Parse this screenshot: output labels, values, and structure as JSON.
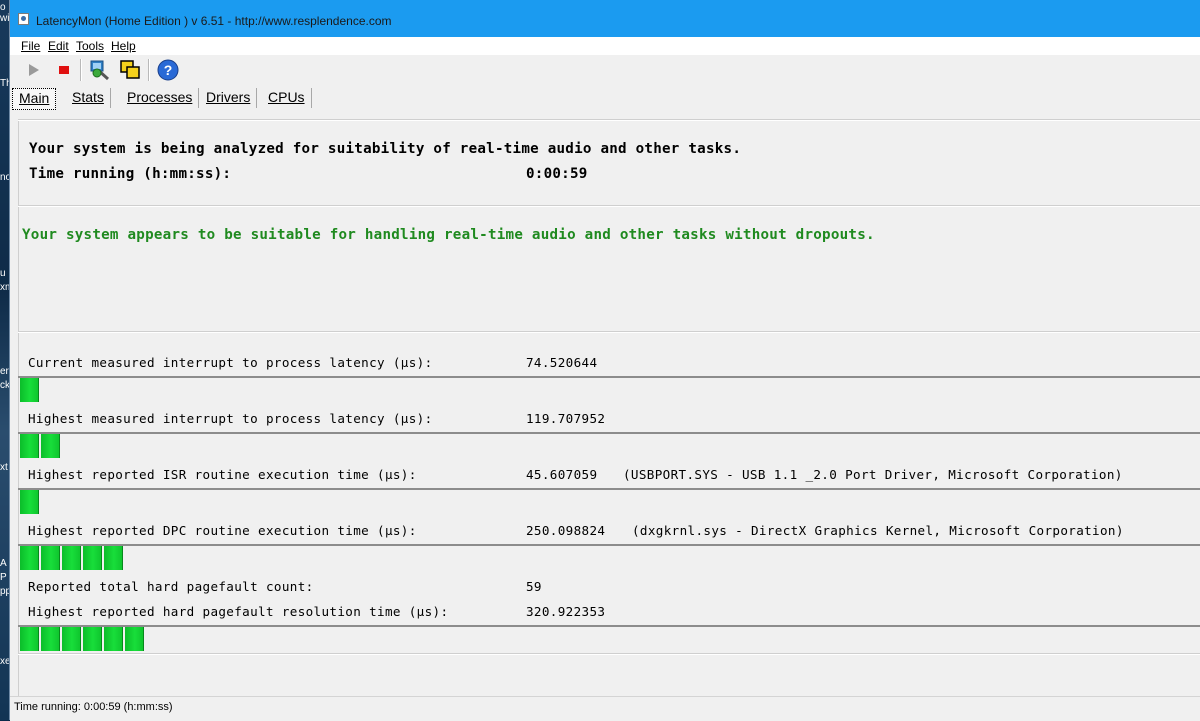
{
  "desktop": {
    "fragments": [
      "o wit",
      "Th",
      "no",
      "u",
      "xm",
      "erp",
      "ck",
      "xt",
      "A",
      "P",
      "pp",
      "xe"
    ]
  },
  "window": {
    "title": "LatencyMon  (Home Edition )  v 6.51 - http://www.resplendence.com"
  },
  "menu": {
    "items": [
      "File",
      "Edit",
      "Tools",
      "Help"
    ]
  },
  "toolbar": {
    "buttons": [
      "play-icon",
      "stop-icon",
      "analyze-icon",
      "windows-icon",
      "help-icon"
    ]
  },
  "tabs": {
    "items": [
      "Main",
      "Stats",
      "Processes",
      "Drivers",
      "CPUs"
    ],
    "active": "Main"
  },
  "main": {
    "analysis_line": "Your system is being analyzed for suitability of real-time audio and other tasks.",
    "time_label": "Time running (h:mm:ss):",
    "time_value": "0:00:59",
    "verdict": "Your system appears to be suitable for handling real-time audio and other tasks without dropouts.",
    "verdict_color": "#1f8a1f",
    "bar_color": "#18de3a",
    "metrics": [
      {
        "label": "Current measured interrupt to process latency (µs):",
        "value": "74.520644",
        "detail": "",
        "bar_segments": 1
      },
      {
        "label": "Highest measured interrupt to process latency (µs):",
        "value": "119.707952",
        "detail": "",
        "bar_segments": 2
      },
      {
        "label": "Highest reported ISR routine execution time (µs):",
        "value": "45.607059",
        "detail": "(USBPORT.SYS - USB 1.1 _2.0 Port Driver, Microsoft Corporation)",
        "bar_segments": 1
      },
      {
        "label": "Highest reported DPC routine execution time (µs):",
        "value": "250.098824",
        "detail": "(dxgkrnl.sys - DirectX Graphics Kernel, Microsoft Corporation)",
        "bar_segments": 5
      }
    ],
    "pagefault_count_label": "Reported total hard pagefault count:",
    "pagefault_count_value": "59",
    "pagefault_time_label": "Highest reported hard pagefault resolution time (µs):",
    "pagefault_time_value": "320.922353",
    "pagefault_bar_segments": 6
  },
  "statusbar": {
    "text": "Time running: 0:00:59  (h:mm:ss)"
  }
}
